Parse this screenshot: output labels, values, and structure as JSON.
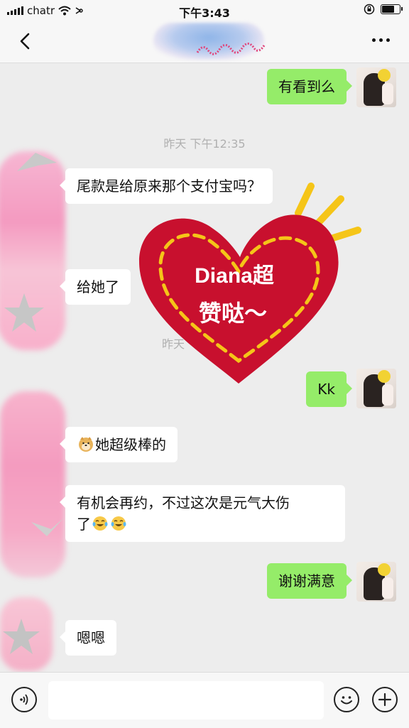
{
  "status_bar": {
    "carrier": "chatr",
    "time": "下午3:43",
    "battery_level": 0.75
  },
  "nav": {
    "back": "back",
    "more": "more"
  },
  "chat": {
    "timestamp_1": "昨天 下午12:35",
    "timestamp_2_partial": "昨天",
    "messages": {
      "m1": "有看到么",
      "m2": "尾款是给原来那个支付宝吗？",
      "m3": "给她了",
      "m4": "Kk",
      "m5": "她超级棒的",
      "m6_line1": "有机会再约，不过这次是元气大伤",
      "m6_line2": "了",
      "m7": "谢谢满意",
      "m8": "嗯嗯"
    }
  },
  "sticker": {
    "line1": "Diana超",
    "line2": "赞哒～",
    "heart_color": "#c8102e",
    "dash_color": "#f5c518"
  },
  "input": {
    "value": ""
  },
  "colors": {
    "self_bubble": "#95ec69",
    "other_bubble": "#ffffff",
    "background": "#ededed"
  }
}
